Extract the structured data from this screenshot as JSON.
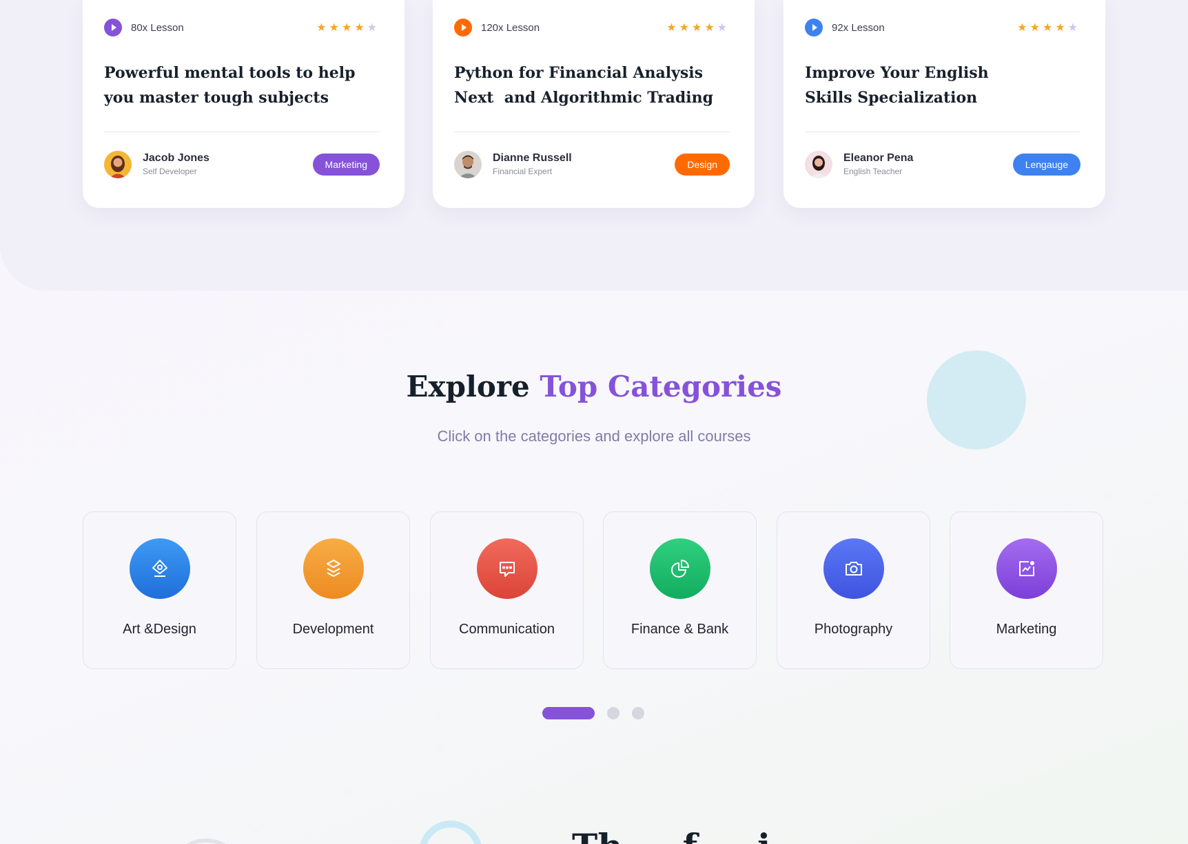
{
  "courses": [
    {
      "lessons": "80x Lesson",
      "rating": 4,
      "rating_max": 5,
      "title": "Powerful mental tools to help you master tough subjects",
      "author": "Jacob Jones",
      "role": "Self Developer",
      "tag": "Marketing",
      "accent": "#8552d9",
      "icon": "play-icon"
    },
    {
      "lessons": "120x Lesson",
      "rating": 4,
      "rating_max": 5,
      "title": "Python for Financial Analysis Next  and Algorithmic Trading",
      "author": "Dianne Russell",
      "role": "Financial Expert",
      "tag": "Design",
      "accent": "#ff6a00",
      "icon": "play-icon"
    },
    {
      "lessons": "92x Lesson",
      "rating": 4,
      "rating_max": 5,
      "title": "Improve Your English Skills Specialization",
      "author": "Eleanor Pena",
      "role": "English Teacher",
      "tag": "Lengauge",
      "accent": "#3d82f0",
      "icon": "play-icon"
    }
  ],
  "categories_section": {
    "title_plain": "Explore",
    "title_highlight": "Top Categories",
    "subtitle": "Click on the categories and explore all courses",
    "highlight_color": "#8552d9"
  },
  "categories": [
    {
      "label": "Art &Design",
      "icon": "art-design-icon",
      "color_from": "#3d9af5",
      "color_to": "#1f6fd9"
    },
    {
      "label": "Development",
      "icon": "layers-icon",
      "color_from": "#f7ad45",
      "color_to": "#ed8b22"
    },
    {
      "label": "Communication",
      "icon": "chat-icon",
      "color_from": "#f06a5c",
      "color_to": "#dc4438"
    },
    {
      "label": "Finance & Bank",
      "icon": "pie-chart-icon",
      "color_from": "#2fd07e",
      "color_to": "#13ac5f"
    },
    {
      "label": "Photography",
      "icon": "camera-icon",
      "color_from": "#5a78f5",
      "color_to": "#3f53df"
    },
    {
      "label": "Marketing",
      "icon": "analytics-icon",
      "color_from": "#a46cf0",
      "color_to": "#7c3fd8"
    }
  ],
  "carousel": {
    "pages": 3,
    "active": 0
  },
  "next_section": {
    "heading_partial": "Th   ...   f   ...   i"
  }
}
